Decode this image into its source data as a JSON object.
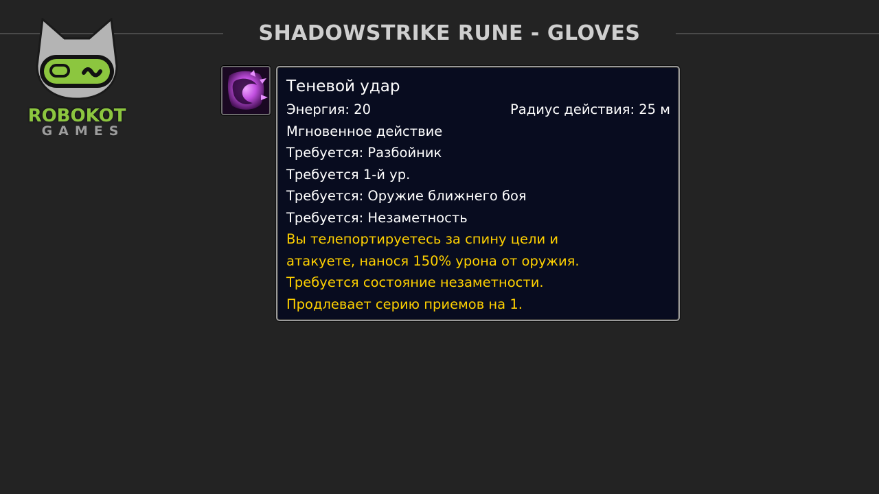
{
  "header": {
    "title": "SHADOWSTRIKE RUNE - GLOVES"
  },
  "logo": {
    "word_top": "ROBOKOT",
    "word_bottom": "GAMES",
    "icon": "robot-cat-icon"
  },
  "spell": {
    "icon": "shadowstrike-spell-icon",
    "name": "Теневой удар",
    "cost": "Энергия: 20",
    "range": "Радиус действия: 25 м",
    "cast": "Мгновенное действие",
    "requirements": [
      "Требуется: Разбойник",
      "Требуется 1-й ур.",
      "Требуется: Оружие ближнего боя",
      "Требуется: Незаметность"
    ],
    "description": [
      "Вы телепортируетесь за спину цели и",
      "атакуете, нанося 150% урона от оружия.",
      "Требуется состояние незаметности.",
      "Продлевает серию приемов на 1."
    ]
  },
  "colors": {
    "background": "#232323",
    "tooltip_bg": "#080c1f",
    "description": "#ffd100",
    "logo_green": "#8cc63f"
  }
}
